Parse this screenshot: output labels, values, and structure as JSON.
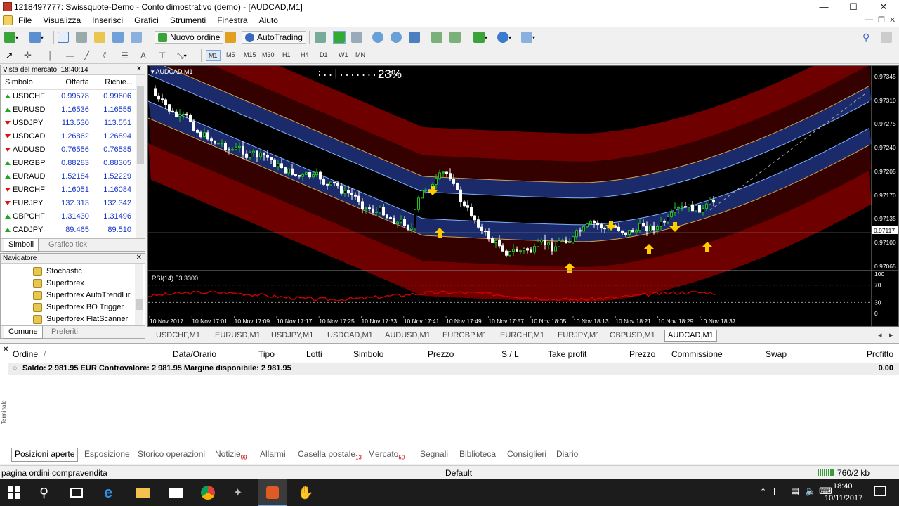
{
  "window": {
    "title": "1218497777: Swissquote-Demo - Conto dimostrativo (demo) - [AUDCAD,M1]",
    "min": "—",
    "max": "☐",
    "close": "✕"
  },
  "menu": [
    "File",
    "Visualizza",
    "Inserisci",
    "Grafici",
    "Strumenti",
    "Finestra",
    "Aiuto"
  ],
  "toolbar": {
    "new_order": "Nuovo ordine",
    "autotrading": "AutoTrading"
  },
  "timeframes": [
    "M1",
    "M5",
    "M15",
    "M30",
    "H1",
    "H4",
    "D1",
    "W1",
    "MN"
  ],
  "market_watch": {
    "header": "Vista del mercato: 18:40:14",
    "col_symbol": "Simbolo",
    "col_bid": "Offerta",
    "col_ask": "Richie...",
    "rows": [
      {
        "symbol": "USDCHF",
        "bid": "0.99578",
        "ask": "0.99606",
        "dir": "up"
      },
      {
        "symbol": "EURUSD",
        "bid": "1.16536",
        "ask": "1.16555",
        "dir": "up"
      },
      {
        "symbol": "USDJPY",
        "bid": "113.530",
        "ask": "113.551",
        "dir": "dn"
      },
      {
        "symbol": "USDCAD",
        "bid": "1.26862",
        "ask": "1.26894",
        "dir": "dn"
      },
      {
        "symbol": "AUDUSD",
        "bid": "0.76556",
        "ask": "0.76585",
        "dir": "dn"
      },
      {
        "symbol": "EURGBP",
        "bid": "0.88283",
        "ask": "0.88305",
        "dir": "up"
      },
      {
        "symbol": "EURAUD",
        "bid": "1.52184",
        "ask": "1.52229",
        "dir": "up"
      },
      {
        "symbol": "EURCHF",
        "bid": "1.16051",
        "ask": "1.16084",
        "dir": "dn"
      },
      {
        "symbol": "EURJPY",
        "bid": "132.313",
        "ask": "132.342",
        "dir": "dn"
      },
      {
        "symbol": "GBPCHF",
        "bid": "1.31430",
        "ask": "1.31496",
        "dir": "up"
      },
      {
        "symbol": "CADJPY",
        "bid": "89.465",
        "ask": "89.510",
        "dir": "up"
      }
    ],
    "tab_symbols": "Simboli",
    "tab_ticks": "Grafico tick"
  },
  "navigator": {
    "header": "Navigatore",
    "items": [
      "Stochastic",
      "Superforex",
      "Superforex AutoTrendLir",
      "Superforex BO Trigger",
      "Superforex FlatScanner"
    ],
    "tab_common": "Comune",
    "tab_favorites": "Preferiti"
  },
  "chart": {
    "label": "AUDCAD,M1",
    "progress_text": "23%",
    "rsi_label": "RSI(14) 53.3300",
    "price_ticks": [
      "0.97345",
      "0.97310",
      "0.97275",
      "0.97240",
      "0.97205",
      "0.97170",
      "0.97135",
      "0.97117",
      "0.97100",
      "0.97065"
    ],
    "current_price": "0.97117",
    "rsi_ticks": [
      "100",
      "70",
      "30",
      "0"
    ],
    "time_ticks": [
      "10 Nov 2017",
      "10 Nov 17:01",
      "10 Nov 17:09",
      "10 Nov 17:17",
      "10 Nov 17:25",
      "10 Nov 17:33",
      "10 Nov 17:41",
      "10 Nov 17:49",
      "10 Nov 17:57",
      "10 Nov 18:05",
      "10 Nov 18:13",
      "10 Nov 18:21",
      "10 Nov 18:29",
      "10 Nov 18:37"
    ],
    "colors": {
      "bull": "#21c021",
      "bear": "#ffffff",
      "band": "#7a0000",
      "channel": "#1b2a6b",
      "arrow": "#ffcc00",
      "rsi": "#d10000"
    }
  },
  "chart_tabs": [
    "USDCHF,M1",
    "EURUSD,M1",
    "USDJPY,M1",
    "USDCAD,M1",
    "AUDUSD,M1",
    "EURGBP,M1",
    "EURCHF,M1",
    "EURJPY,M1",
    "GBPUSD,M1",
    "AUDCAD,M1"
  ],
  "terminal": {
    "columns": [
      "Ordine",
      "Data/Orario",
      "Tipo",
      "Lotti",
      "Simbolo",
      "Prezzo",
      "S / L",
      "Take profit",
      "Prezzo",
      "Commissione",
      "Swap",
      "Profitto"
    ],
    "sort_marker": "/",
    "balance": "Saldo: 2 981.95 EUR  Controvalore: 2 981.95  Margine disponibile: 2 981.95",
    "profit": "0.00",
    "side_label": "Terminale",
    "tabs": [
      {
        "label": "Posizioni aperte",
        "badge": ""
      },
      {
        "label": "Esposizione",
        "badge": ""
      },
      {
        "label": "Storico operazioni",
        "badge": ""
      },
      {
        "label": "Notizie",
        "badge": "99"
      },
      {
        "label": "Allarmi",
        "badge": ""
      },
      {
        "label": "Casella postale",
        "badge": "13"
      },
      {
        "label": "Mercato",
        "badge": "50"
      },
      {
        "label": "Segnali",
        "badge": ""
      },
      {
        "label": "Biblioteca",
        "badge": ""
      },
      {
        "label": "Consiglieri",
        "badge": ""
      },
      {
        "label": "Diario",
        "badge": ""
      }
    ]
  },
  "status": {
    "left": "pagina ordini compravendita",
    "profile": "Default",
    "traffic": "760/2 kb"
  },
  "taskbar": {
    "time": "18:40",
    "date": "10/11/2017"
  }
}
